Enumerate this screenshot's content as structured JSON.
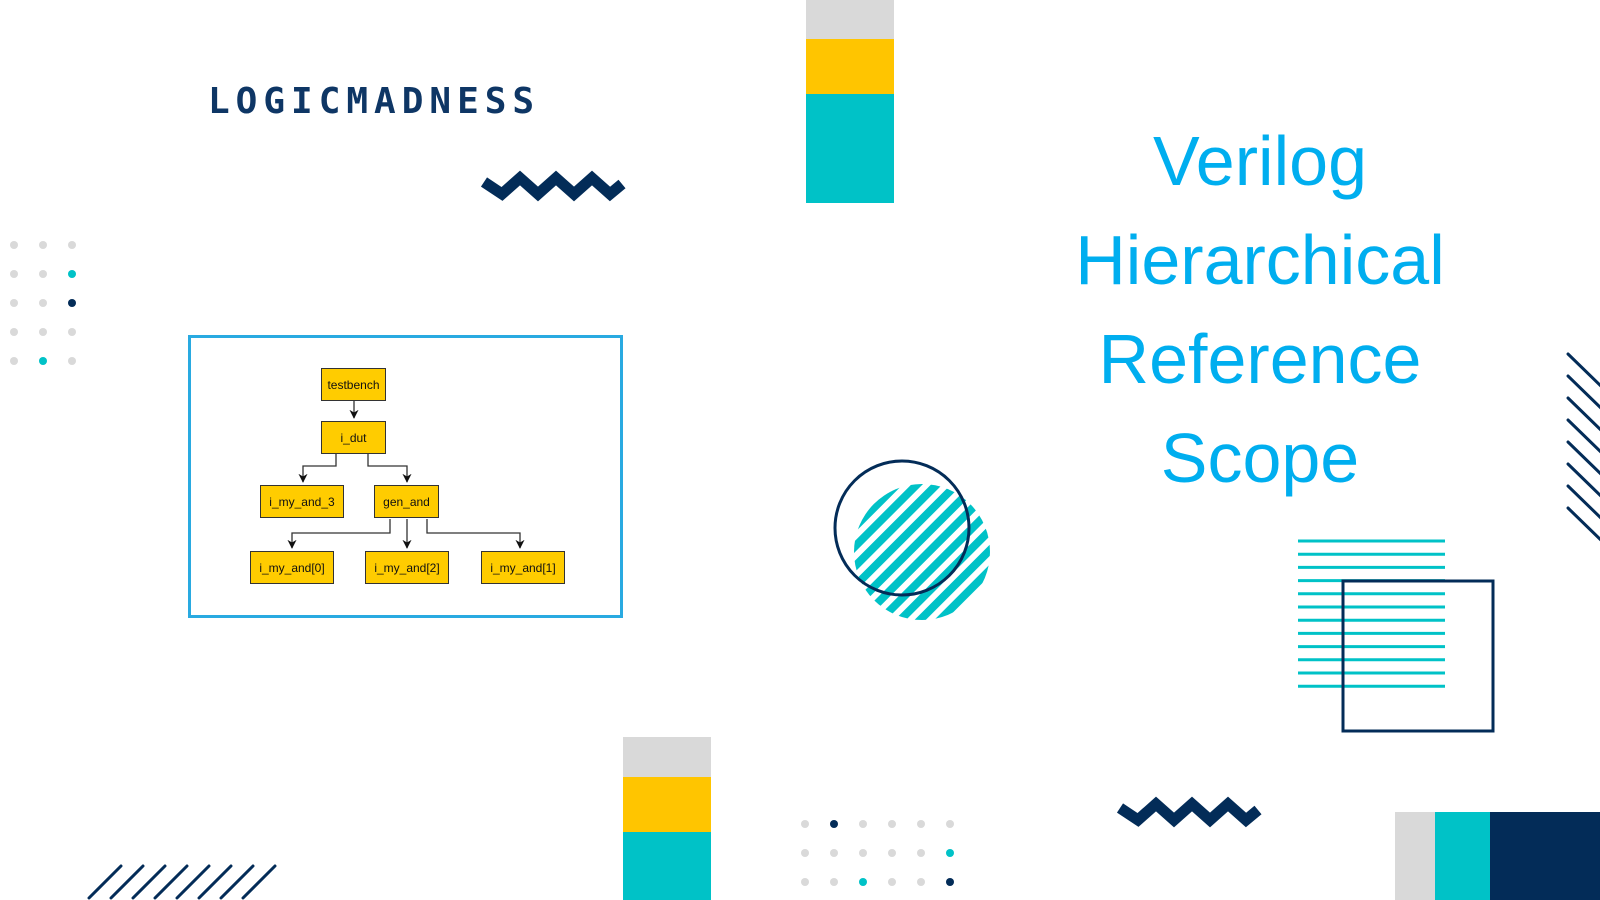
{
  "brand": {
    "logo_text": "LOGICMADNESS"
  },
  "title": {
    "lines": [
      "Verilog",
      "Hierarchical",
      "Reference",
      "Scope"
    ],
    "color": "#00aeef"
  },
  "palette": {
    "navy": "#032c58",
    "teal": "#00c2c7",
    "yellow": "#ffc500",
    "light_gray": "#d9d9d9",
    "frame_blue": "#29aae1",
    "node_fill": "#ffcc00"
  },
  "diagram": {
    "nodes": {
      "testbench": "testbench",
      "i_dut": "i_dut",
      "i_my_and_3": "i_my_and_3",
      "gen_and": "gen_and",
      "i_my_and_0": "i_my_and[0]",
      "i_my_and_2": "i_my_and[2]",
      "i_my_and_1": "i_my_and[1]"
    },
    "edges": [
      [
        "testbench",
        "i_dut"
      ],
      [
        "i_dut",
        "i_my_and_3"
      ],
      [
        "i_dut",
        "gen_and"
      ],
      [
        "gen_and",
        "i_my_and_0"
      ],
      [
        "gen_and",
        "i_my_and_2"
      ],
      [
        "gen_and",
        "i_my_and_1"
      ]
    ]
  },
  "dot_grids": {
    "left": {
      "cols": 3,
      "rows": 5,
      "accents": [
        [
          1,
          2,
          "teal"
        ],
        [
          2,
          2,
          "navy"
        ],
        [
          4,
          1,
          "teal"
        ]
      ]
    },
    "bottom": {
      "cols": 6,
      "rows": 3,
      "accents": [
        [
          0,
          1,
          "navy"
        ],
        [
          1,
          5,
          "teal"
        ],
        [
          2,
          2,
          "teal"
        ],
        [
          2,
          5,
          "navy"
        ]
      ]
    }
  }
}
